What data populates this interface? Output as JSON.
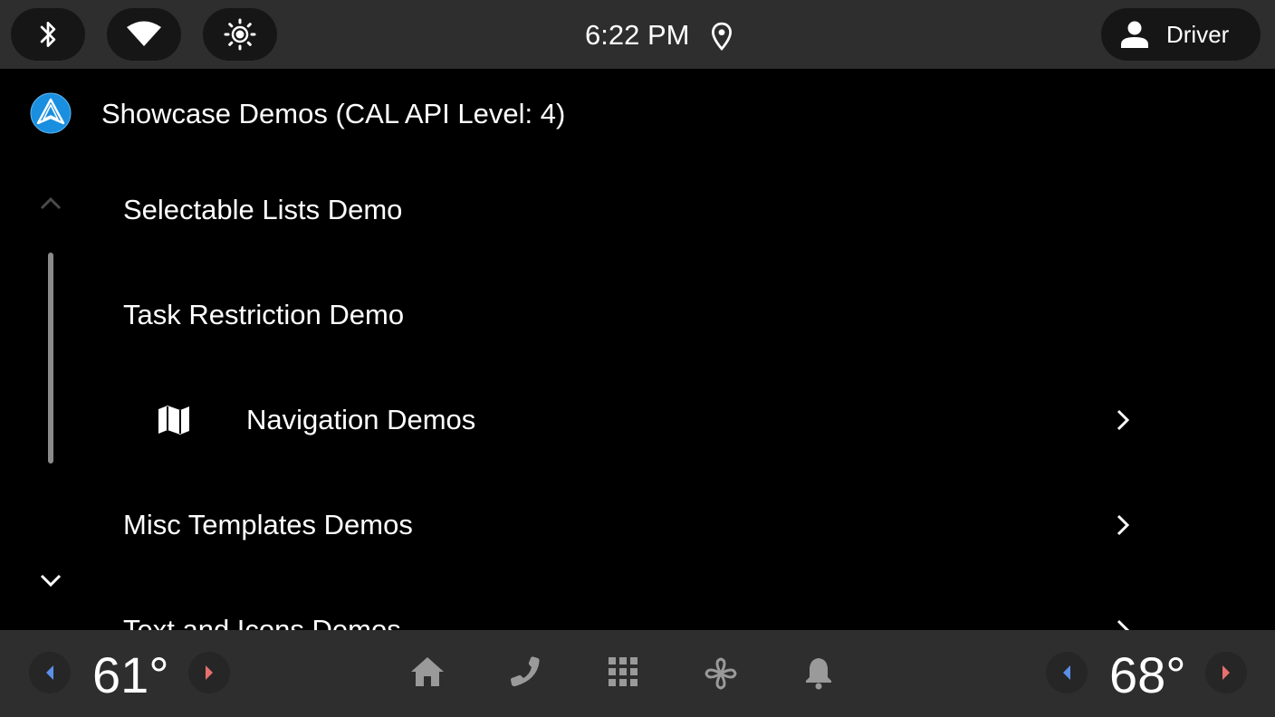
{
  "status_bar": {
    "icons": [
      "bluetooth-icon",
      "wifi-icon",
      "brightness-icon",
      "location-icon"
    ],
    "time": "6:22 PM",
    "profile": {
      "name": "Driver",
      "icon": "person-icon"
    }
  },
  "app": {
    "title": "Showcase Demos (CAL API Level: 4)",
    "logo_icon": "android-auto-logo",
    "logo_color": "#1a8fe0"
  },
  "list": {
    "items": [
      {
        "label": "Selectable Lists Demo",
        "icon": null,
        "has_chevron": false
      },
      {
        "label": "Task Restriction Demo",
        "icon": null,
        "has_chevron": false
      },
      {
        "label": "Navigation Demos",
        "icon": "map-icon",
        "has_chevron": true
      },
      {
        "label": "Misc Templates Demos",
        "icon": null,
        "has_chevron": true
      },
      {
        "label": "Text and Icons Demos",
        "icon": null,
        "has_chevron": true
      }
    ],
    "scroll": {
      "position": 0.55
    }
  },
  "nav_bar": {
    "left_temp": "61°",
    "right_temp": "68°",
    "icons": [
      "home-icon",
      "phone-icon",
      "app-grid-icon",
      "fan-icon",
      "notifications-icon"
    ],
    "decrease_color": "#5b8fe8",
    "increase_color": "#e86f6f"
  }
}
